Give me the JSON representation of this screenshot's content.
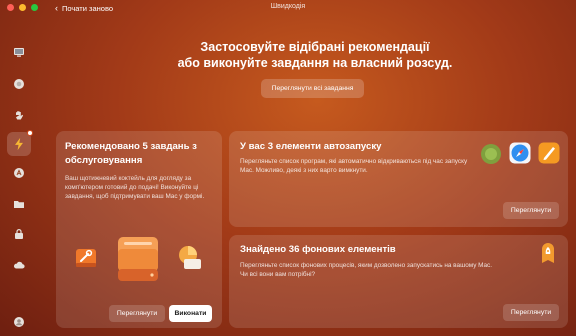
{
  "window": {
    "app_title": "Швидкодія",
    "back_label": "Почати заново"
  },
  "sidebar": {
    "items": [
      {
        "icon": "monitor-icon"
      },
      {
        "icon": "shield-icon"
      },
      {
        "icon": "hand-icon"
      },
      {
        "icon": "lightning-icon",
        "active": true
      },
      {
        "icon": "apps-icon"
      },
      {
        "icon": "folder-icon"
      },
      {
        "icon": "lock-icon"
      },
      {
        "icon": "cloud-icon"
      },
      {
        "icon": "user-icon"
      }
    ]
  },
  "hero": {
    "line1": "Застосовуйте відібрані рекомендації",
    "line2": "або виконуйте завдання на власний розсуд.",
    "review_all_label": "Переглянути всі завдання"
  },
  "maintenance_card": {
    "title": "Рекомендовано 5 завдань з обслуговування",
    "description": "Ваш щотижневий коктейль для догляду за комп'ютером готовий до подачі! Виконуйте ці завдання, щоб підтримувати ваш Mac у формі.",
    "review_label": "Переглянути",
    "run_label": "Виконати",
    "icons": [
      "wrench-icon",
      "disk-icon",
      "pie-chart-icon"
    ]
  },
  "login_items_card": {
    "title": "У вас 3 елементи автозапуску",
    "description": "Перегляньте список програм, які автоматично відкриваються під час запуску Mac. Можливо, деякі з них варто вимкнути.",
    "review_label": "Переглянути",
    "icons": [
      "green-app-icon",
      "safari-icon",
      "pencil-app-icon"
    ]
  },
  "background_items_card": {
    "title": "Знайдено 36 фонових елементів",
    "description": "Перегляньте список фонових процесів, яким дозволено запускатись на вашому Mac. Чи всі вони вам потрібні?",
    "review_label": "Переглянути",
    "icons": [
      "rocket-badge-icon"
    ]
  },
  "colors": {
    "background_center": "#c65a1e",
    "background_edge": "#6e1f10",
    "accent_orange": "#f08a2a"
  }
}
